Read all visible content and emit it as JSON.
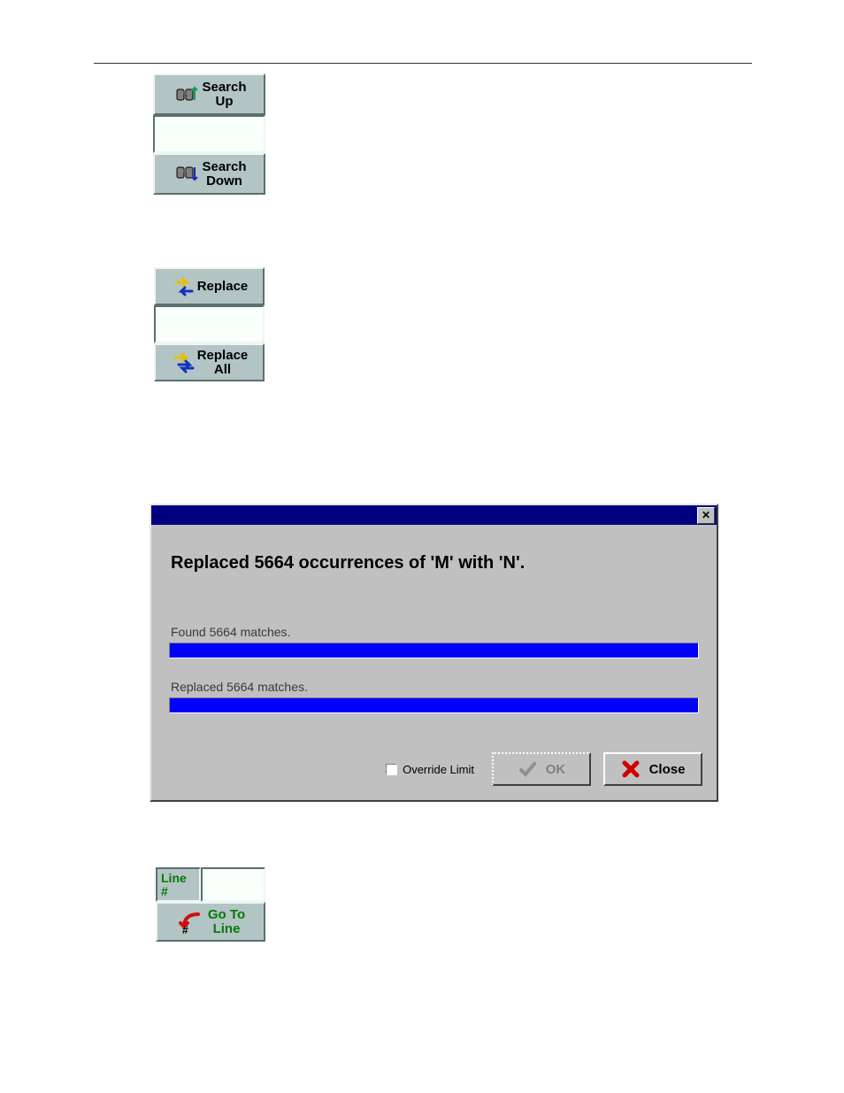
{
  "search_panel": {
    "search_up": {
      "line1": "Search",
      "line2": "Up"
    },
    "search_input": "",
    "search_down": {
      "line1": "Search",
      "line2": "Down"
    }
  },
  "replace_panel": {
    "replace": {
      "label": "Replace"
    },
    "replace_input": "",
    "replace_all": {
      "line1": "Replace",
      "line2": "All"
    }
  },
  "dialog": {
    "title": "Replaced 5664 occurrences of 'M' with 'N'.",
    "found_label": "Found 5664 matches.",
    "found_progress_pct": 100,
    "replaced_label": "Replaced 5664 matches.",
    "replaced_progress_pct": 100,
    "override_limit_label": "Override Limit",
    "override_limit_checked": false,
    "ok_label": "OK",
    "ok_enabled": false,
    "close_label": "Close"
  },
  "goto_panel": {
    "line_label_1": "Line",
    "line_label_2": "#",
    "line_input": "",
    "goto_line": {
      "line1": "Go To",
      "line2": "Line"
    }
  }
}
